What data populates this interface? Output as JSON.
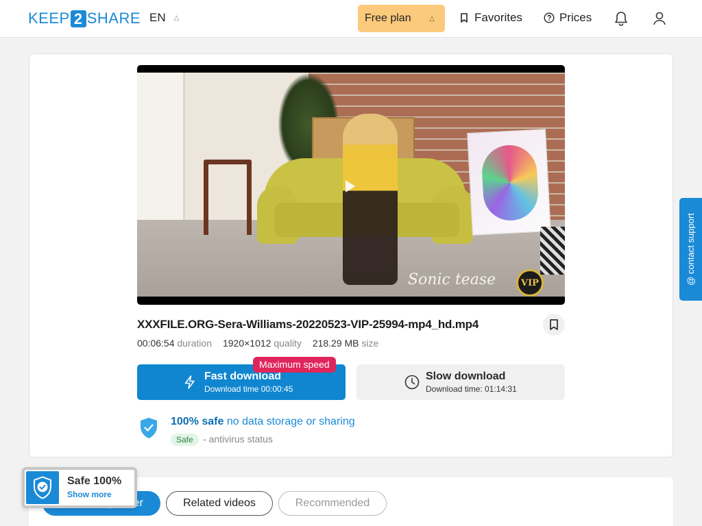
{
  "header": {
    "logo_left": "KEEP",
    "logo_mid": "2",
    "logo_right": "SHARE",
    "language": "EN",
    "plan_label": "Free plan",
    "favorites_label": "Favorites",
    "prices_label": "Prices"
  },
  "video": {
    "watermark": "Sonic tease",
    "badge": "VIP"
  },
  "file": {
    "name": "XXXFILE.ORG-Sera-Williams-20220523-VIP-25994-mp4_hd.mp4",
    "duration_value": "00:06:54",
    "duration_label": "duration",
    "quality_value": "1920×1012",
    "quality_label": "quality",
    "size_value": "218.29 MB",
    "size_label": "size"
  },
  "download": {
    "fast_title": "Fast download",
    "fast_sub": "Download time 00:00:45",
    "max_speed_badge": "Maximum speed",
    "slow_title": "Slow download",
    "slow_sub": "Download time: 01:14:31"
  },
  "safety": {
    "headline_bold": "100% safe",
    "headline_rest": "no data storage or sharing",
    "badge": "Safe",
    "status": "- antivirus status"
  },
  "support": {
    "label": "@ contact support"
  },
  "tabs": [
    {
      "label": "From this partner"
    },
    {
      "label": "Related videos"
    },
    {
      "label": "Recommended"
    }
  ],
  "safe_popup": {
    "title": "Safe 100%",
    "link": "Show more"
  },
  "colors": {
    "brand": "#1a8ad6",
    "plan": "#fcca7c",
    "badge_red": "#e0255a"
  }
}
